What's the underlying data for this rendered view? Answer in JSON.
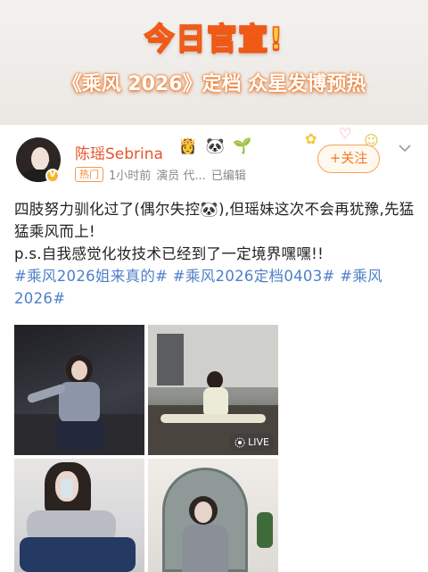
{
  "banner": {
    "title": "今日官宣!",
    "subtitle": "《乘风 2026》定档 众星发博预热"
  },
  "post": {
    "username": "陈瑶Sebrina",
    "name_icons": [
      "👸",
      "🐼",
      "🌱"
    ],
    "hot_badge": "热门",
    "time": "1小时前",
    "source": "演员 代...",
    "edited": "已编辑",
    "follow_label": "+关注",
    "text_plain_1": "四肢努力驯化过了(偶尔失控🐼),但瑶妹这次不会再犹豫,先猛猛乘风而上!",
    "text_plain_2": "p.s.自我感觉化妆技术已经到了一定境界嘿嘿!!",
    "tag_1": "#乘风2026姐来真的#",
    "tag_2": "#乘风2026定档0403#",
    "tag_3": "#乘风2026#",
    "live_label": "LIVE"
  },
  "colors": {
    "username": "#e8552b",
    "hashtag": "#4e7fc8",
    "follow": "#f07a26",
    "banner_title": "#ffcf3a"
  },
  "icons": [
    "verified-badge-icon",
    "chevron-down-icon",
    "live-photo-icon",
    "flower-decoration-icon"
  ]
}
